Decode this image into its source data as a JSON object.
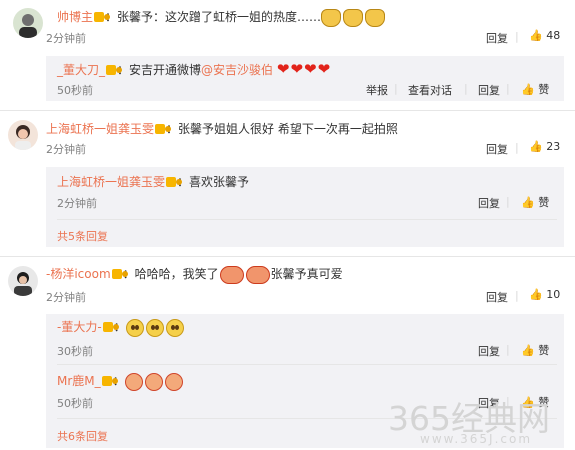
{
  "comments": [
    {
      "author": "帅博主",
      "text": "：张馨予：这次蹭了虹桥一姐的热度……",
      "time": "2分钟前",
      "actions": {
        "reply": "回复",
        "likes": "48"
      },
      "replies": [
        {
          "author": "_董大刀_",
          "text": "：安吉开通微博",
          "mention": "@安吉沙骏伯",
          "time": "50秒前",
          "actions": {
            "report": "举报",
            "view": "查看对话",
            "reply": "回复",
            "like": "赞"
          }
        }
      ],
      "more": ""
    },
    {
      "author": "上海虹桥一姐龚玉雯",
      "text": "：张馨予姐姐人很好 希望下一次再一起拍照",
      "time": "2分钟前",
      "actions": {
        "reply": "回复",
        "likes": "23"
      },
      "replies": [
        {
          "author": "上海虹桥一姐龚玉雯",
          "text": "：喜欢张馨予",
          "time": "2分钟前",
          "actions": {
            "reply": "回复",
            "like": "赞"
          }
        }
      ],
      "more": "共5条回复"
    },
    {
      "author": "-杨洋icoom",
      "text_a": "：哈哈哈，我笑了",
      "text_b": "张馨予真可爱",
      "time": "2分钟前",
      "actions": {
        "reply": "回复",
        "likes": "10"
      },
      "replies": [
        {
          "author": "-董大力-",
          "text": "：",
          "time": "30秒前",
          "actions": {
            "reply": "回复",
            "like": "赞"
          }
        },
        {
          "author": "Mr鹿M_",
          "text": "：",
          "time": "50秒前",
          "actions": {
            "reply": "回复",
            "like": "赞"
          }
        }
      ],
      "more": "共6条回复"
    }
  ],
  "icons": {
    "reply": "reply-icon",
    "like": "thumbs-up-icon",
    "verified": "verified-badge-icon"
  },
  "colors": {
    "name": "#eb7350",
    "heart": "#e2231a",
    "reply_bg": "#f2f2f5",
    "time": "#808080"
  },
  "watermark": {
    "main": "365经典网",
    "url": "www.365J.com"
  }
}
